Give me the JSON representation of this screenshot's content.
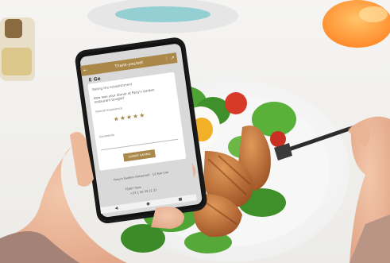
{
  "app": {
    "title": "Thank-you/eet",
    "brand": "E Ge",
    "headline": "Rating the establishment",
    "question": "How was your dinner at Rosy's Garden restaurant tonight?",
    "rating_label": "Overall experience",
    "stars": "★★★★★",
    "comment_label": "Comments",
    "submit_label": "SUBMIT RATING",
    "footer_line1": "Rosy's Garden restaurant · 12 Rue Cler",
    "footer_line2": "75007 Paris",
    "footer_line3": "+33 1 45 55 21 21",
    "icons": {
      "back": "←",
      "menu": "⋮",
      "share": "↗",
      "nav_back": "◀",
      "nav_home": "●",
      "nav_recent": "■"
    }
  }
}
